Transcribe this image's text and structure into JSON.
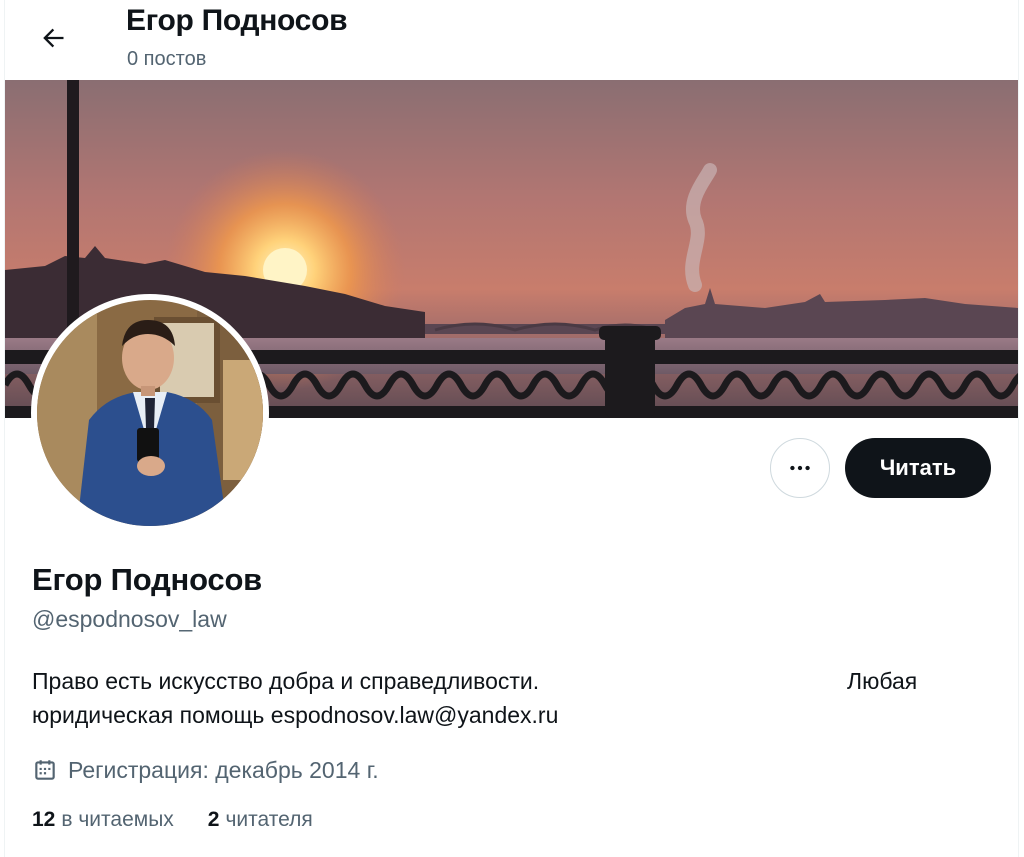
{
  "header": {
    "name": "Егор Подносов",
    "posts_count": "0 постов",
    "back_icon": "arrow-left-icon"
  },
  "profile": {
    "name": "Егор Подносов",
    "handle": "@espodnosov_law",
    "bio_line1": "Право есть искусство добра и справедливости.",
    "bio_extra": "Любая",
    "bio_line2": "юридическая помощь espodnosov.law@yandex.ru",
    "joined": "Регистрация: декабрь 2014 г.",
    "joined_icon": "calendar-icon"
  },
  "actions": {
    "more_icon": "more-icon",
    "follow_label": "Читать"
  },
  "stats": {
    "following_count": "12",
    "following_label": "в читаемых",
    "followers_count": "2",
    "followers_label": "читателя"
  },
  "colors": {
    "text_primary": "#0f1419",
    "text_secondary": "#536471",
    "button_dark": "#0f1419",
    "border": "#cfd9de"
  }
}
